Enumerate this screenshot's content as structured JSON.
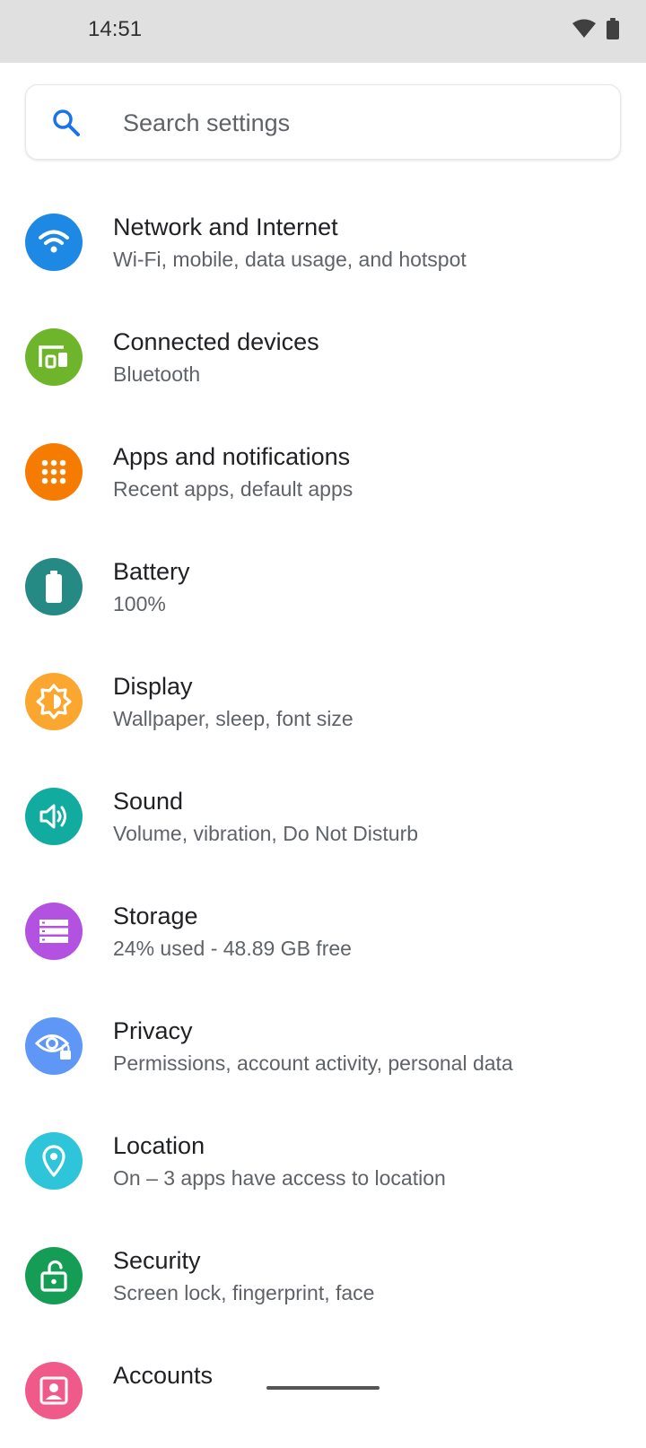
{
  "status_bar": {
    "time": "14:51",
    "icons": [
      "wifi-icon",
      "battery-icon"
    ]
  },
  "search": {
    "placeholder": "Search settings",
    "icon": "search-icon",
    "icon_color": "#1a73e8"
  },
  "settings": [
    {
      "id": "network",
      "title": "Network and Internet",
      "subtitle": "Wi-Fi, mobile, data usage, and hotspot",
      "icon": "wifi-icon",
      "color": "#1e88e5"
    },
    {
      "id": "connected-devices",
      "title": "Connected devices",
      "subtitle": "Bluetooth",
      "icon": "devices-icon",
      "color": "#6fb52c"
    },
    {
      "id": "apps",
      "title": "Apps and notifications",
      "subtitle": "Recent apps, default apps",
      "icon": "apps-grid-icon",
      "color": "#f57c00"
    },
    {
      "id": "battery",
      "title": "Battery",
      "subtitle": "100%",
      "icon": "battery-icon",
      "color": "#268a84"
    },
    {
      "id": "display",
      "title": "Display",
      "subtitle": "Wallpaper, sleep, font size",
      "icon": "brightness-icon",
      "color": "#fba62e"
    },
    {
      "id": "sound",
      "title": "Sound",
      "subtitle": "Volume, vibration, Do Not Disturb",
      "icon": "speaker-icon",
      "color": "#11aba0"
    },
    {
      "id": "storage",
      "title": "Storage",
      "subtitle": "24% used - 48.89 GB free",
      "icon": "storage-icon",
      "color": "#b352e0"
    },
    {
      "id": "privacy",
      "title": "Privacy",
      "subtitle": "Permissions, account activity, personal data",
      "icon": "privacy-eye-icon",
      "color": "#5e97f6"
    },
    {
      "id": "location",
      "title": "Location",
      "subtitle": "On – 3 apps have access to location",
      "icon": "location-pin-icon",
      "color": "#2ec4d9"
    },
    {
      "id": "security",
      "title": "Security",
      "subtitle": "Screen lock, fingerprint, face",
      "icon": "lock-open-icon",
      "color": "#159d55"
    },
    {
      "id": "accounts",
      "title": "Accounts",
      "subtitle": "",
      "icon": "account-icon",
      "color": "#ef5a8a"
    }
  ]
}
